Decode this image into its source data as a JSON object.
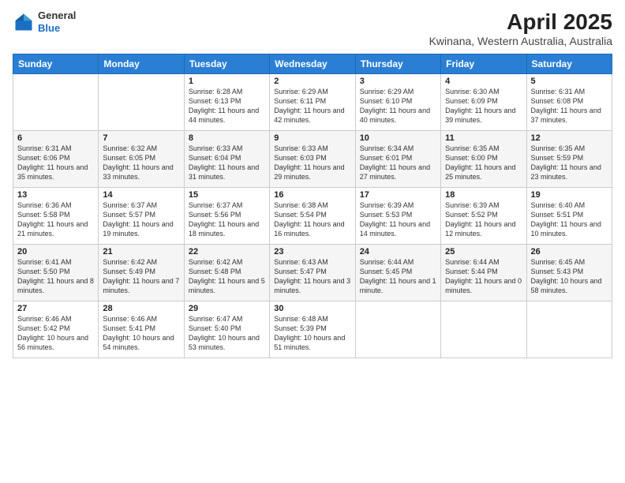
{
  "logo": {
    "general": "General",
    "blue": "Blue"
  },
  "header": {
    "title": "April 2025",
    "subtitle": "Kwinana, Western Australia, Australia"
  },
  "weekdays": [
    "Sunday",
    "Monday",
    "Tuesday",
    "Wednesday",
    "Thursday",
    "Friday",
    "Saturday"
  ],
  "weeks": [
    [
      {
        "day": "",
        "sunrise": "",
        "sunset": "",
        "daylight": ""
      },
      {
        "day": "",
        "sunrise": "",
        "sunset": "",
        "daylight": ""
      },
      {
        "day": "1",
        "sunrise": "Sunrise: 6:28 AM",
        "sunset": "Sunset: 6:13 PM",
        "daylight": "Daylight: 11 hours and 44 minutes."
      },
      {
        "day": "2",
        "sunrise": "Sunrise: 6:29 AM",
        "sunset": "Sunset: 6:11 PM",
        "daylight": "Daylight: 11 hours and 42 minutes."
      },
      {
        "day": "3",
        "sunrise": "Sunrise: 6:29 AM",
        "sunset": "Sunset: 6:10 PM",
        "daylight": "Daylight: 11 hours and 40 minutes."
      },
      {
        "day": "4",
        "sunrise": "Sunrise: 6:30 AM",
        "sunset": "Sunset: 6:09 PM",
        "daylight": "Daylight: 11 hours and 39 minutes."
      },
      {
        "day": "5",
        "sunrise": "Sunrise: 6:31 AM",
        "sunset": "Sunset: 6:08 PM",
        "daylight": "Daylight: 11 hours and 37 minutes."
      }
    ],
    [
      {
        "day": "6",
        "sunrise": "Sunrise: 6:31 AM",
        "sunset": "Sunset: 6:06 PM",
        "daylight": "Daylight: 11 hours and 35 minutes."
      },
      {
        "day": "7",
        "sunrise": "Sunrise: 6:32 AM",
        "sunset": "Sunset: 6:05 PM",
        "daylight": "Daylight: 11 hours and 33 minutes."
      },
      {
        "day": "8",
        "sunrise": "Sunrise: 6:33 AM",
        "sunset": "Sunset: 6:04 PM",
        "daylight": "Daylight: 11 hours and 31 minutes."
      },
      {
        "day": "9",
        "sunrise": "Sunrise: 6:33 AM",
        "sunset": "Sunset: 6:03 PM",
        "daylight": "Daylight: 11 hours and 29 minutes."
      },
      {
        "day": "10",
        "sunrise": "Sunrise: 6:34 AM",
        "sunset": "Sunset: 6:01 PM",
        "daylight": "Daylight: 11 hours and 27 minutes."
      },
      {
        "day": "11",
        "sunrise": "Sunrise: 6:35 AM",
        "sunset": "Sunset: 6:00 PM",
        "daylight": "Daylight: 11 hours and 25 minutes."
      },
      {
        "day": "12",
        "sunrise": "Sunrise: 6:35 AM",
        "sunset": "Sunset: 5:59 PM",
        "daylight": "Daylight: 11 hours and 23 minutes."
      }
    ],
    [
      {
        "day": "13",
        "sunrise": "Sunrise: 6:36 AM",
        "sunset": "Sunset: 5:58 PM",
        "daylight": "Daylight: 11 hours and 21 minutes."
      },
      {
        "day": "14",
        "sunrise": "Sunrise: 6:37 AM",
        "sunset": "Sunset: 5:57 PM",
        "daylight": "Daylight: 11 hours and 19 minutes."
      },
      {
        "day": "15",
        "sunrise": "Sunrise: 6:37 AM",
        "sunset": "Sunset: 5:56 PM",
        "daylight": "Daylight: 11 hours and 18 minutes."
      },
      {
        "day": "16",
        "sunrise": "Sunrise: 6:38 AM",
        "sunset": "Sunset: 5:54 PM",
        "daylight": "Daylight: 11 hours and 16 minutes."
      },
      {
        "day": "17",
        "sunrise": "Sunrise: 6:39 AM",
        "sunset": "Sunset: 5:53 PM",
        "daylight": "Daylight: 11 hours and 14 minutes."
      },
      {
        "day": "18",
        "sunrise": "Sunrise: 6:39 AM",
        "sunset": "Sunset: 5:52 PM",
        "daylight": "Daylight: 11 hours and 12 minutes."
      },
      {
        "day": "19",
        "sunrise": "Sunrise: 6:40 AM",
        "sunset": "Sunset: 5:51 PM",
        "daylight": "Daylight: 11 hours and 10 minutes."
      }
    ],
    [
      {
        "day": "20",
        "sunrise": "Sunrise: 6:41 AM",
        "sunset": "Sunset: 5:50 PM",
        "daylight": "Daylight: 11 hours and 8 minutes."
      },
      {
        "day": "21",
        "sunrise": "Sunrise: 6:42 AM",
        "sunset": "Sunset: 5:49 PM",
        "daylight": "Daylight: 11 hours and 7 minutes."
      },
      {
        "day": "22",
        "sunrise": "Sunrise: 6:42 AM",
        "sunset": "Sunset: 5:48 PM",
        "daylight": "Daylight: 11 hours and 5 minutes."
      },
      {
        "day": "23",
        "sunrise": "Sunrise: 6:43 AM",
        "sunset": "Sunset: 5:47 PM",
        "daylight": "Daylight: 11 hours and 3 minutes."
      },
      {
        "day": "24",
        "sunrise": "Sunrise: 6:44 AM",
        "sunset": "Sunset: 5:45 PM",
        "daylight": "Daylight: 11 hours and 1 minute."
      },
      {
        "day": "25",
        "sunrise": "Sunrise: 6:44 AM",
        "sunset": "Sunset: 5:44 PM",
        "daylight": "Daylight: 11 hours and 0 minutes."
      },
      {
        "day": "26",
        "sunrise": "Sunrise: 6:45 AM",
        "sunset": "Sunset: 5:43 PM",
        "daylight": "Daylight: 10 hours and 58 minutes."
      }
    ],
    [
      {
        "day": "27",
        "sunrise": "Sunrise: 6:46 AM",
        "sunset": "Sunset: 5:42 PM",
        "daylight": "Daylight: 10 hours and 56 minutes."
      },
      {
        "day": "28",
        "sunrise": "Sunrise: 6:46 AM",
        "sunset": "Sunset: 5:41 PM",
        "daylight": "Daylight: 10 hours and 54 minutes."
      },
      {
        "day": "29",
        "sunrise": "Sunrise: 6:47 AM",
        "sunset": "Sunset: 5:40 PM",
        "daylight": "Daylight: 10 hours and 53 minutes."
      },
      {
        "day": "30",
        "sunrise": "Sunrise: 6:48 AM",
        "sunset": "Sunset: 5:39 PM",
        "daylight": "Daylight: 10 hours and 51 minutes."
      },
      {
        "day": "",
        "sunrise": "",
        "sunset": "",
        "daylight": ""
      },
      {
        "day": "",
        "sunrise": "",
        "sunset": "",
        "daylight": ""
      },
      {
        "day": "",
        "sunrise": "",
        "sunset": "",
        "daylight": ""
      }
    ]
  ]
}
